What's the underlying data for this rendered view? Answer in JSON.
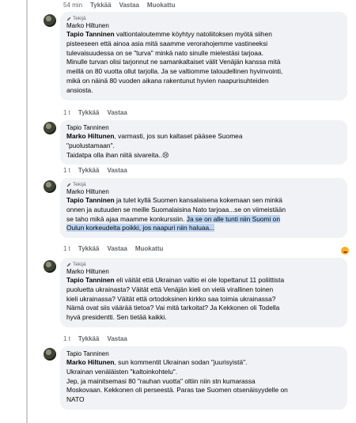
{
  "top_actions": {
    "time": "54 min",
    "like": "Tykkää",
    "reply": "Vastaa",
    "edited": "Muokattu"
  },
  "comments": [
    {
      "badge": "Tekijä",
      "author": "Marko Hiltunen",
      "mention": "Tapio Tanninen",
      "lines": [
        " valtiontaloutemme köyhtyy natoliitoksen myötä siihen",
        "pisteeseen että ainoa asia mitä saamme verorahojemme vastineeksi",
        "tulevaisuudessa on se \"turva\" minkä nato sinulle mielestäsi tarjoaa.",
        "Minulle turvan olisi tarjonnut ne samankaltaiset välit Venäjän kanssa mitä",
        "meillä on 80 vuotta ollut tarjolla. Ja se valtiomme taloudellinen hyvinvointi,",
        "mikä on näinä 80 vuoden aikana rakentunut hyvien naapurisuhteiden",
        "ansiosta."
      ],
      "actions": {
        "time": "1 t",
        "like": "Tykkää",
        "reply": "Vastaa",
        "edited": ""
      }
    },
    {
      "badge": "",
      "author": "Tapio Tanninen",
      "mention": "Marko Hiltunen",
      "lines": [
        ", varmasti, jos sun kaltaset pääsee Suomea",
        "\"puolustamaan\".",
        "Taidatpa olla ihan niitä sivareita..😢"
      ],
      "actions": {
        "time": "1 t",
        "like": "Tykkää",
        "reply": "Vastaa",
        "edited": ""
      }
    },
    {
      "badge": "Tekijä",
      "author": "Marko Hiltunen",
      "mention": "Tapio Tanninen",
      "lines": [
        " ja tulet kyllä Suomen kansalaisena kokemaan sen minkä",
        "onnen ja autuuden se meille Suomalaisina Nato tarjoaa...se on viimeistään",
        "se taho mikä ajaa maamme konkurssiin. ",
        "Ja se on alle tunti niin Suomi on",
        "Oulun korkeudelta poikki, jos naapuri niin haluaa..."
      ],
      "actions": {
        "time": "1 t",
        "like": "Tykkää",
        "reply": "Vastaa",
        "edited": "Muokattu"
      }
    },
    {
      "badge": "Tekijä",
      "author": "Marko Hiltunen",
      "mention": "Tapio Tanninen",
      "lines": [
        " eli väität että Ukrainan valtio ei ole lopettanut 11 poliittista",
        "puoluetta ukrainasta? Väität että Venäjän kieli on vielä virallinen toinen",
        "kieli ukrainassa? Väität että ortodoksinen kirkko saa toimia ukrainassa?",
        "Nämä ovat siis väärää tietoa? Vai mitä tarkoitat? Ja Kekkonen oli Todella",
        "hyvä presidentti. Sen tietää kaikki."
      ],
      "actions": {
        "time": "1 t",
        "like": "Tykkää",
        "reply": "Vastaa",
        "edited": ""
      }
    },
    {
      "badge": "",
      "author": "Tapio Tanninen",
      "mention": "Marko Hiltunen",
      "lines": [
        ", sun kommentit Ukrainan sodan \"juurisyistä\".",
        "Ukrainan venäläisten \"kaltoinkohtelu\".",
        "Jep, ja mainitsemasi 80 \"rauhan vuotta\" oltiin niin stn kumarassa",
        "Moskovaan. Kekkonen oli perseestä. Paras tae Suomen otsenäisyydelle on",
        "NATO"
      ],
      "actions": {
        "time": "",
        "like": "",
        "reply": "",
        "edited": ""
      }
    }
  ]
}
